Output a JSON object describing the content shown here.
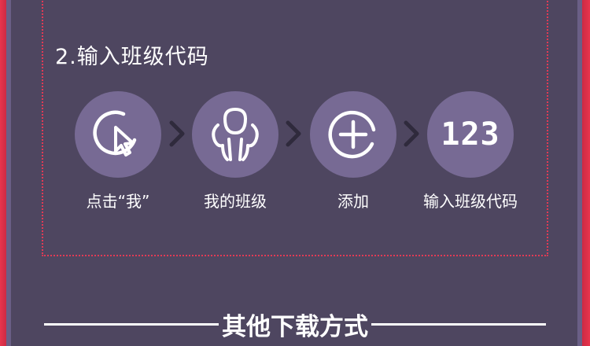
{
  "section": {
    "title": "2.输入班级代码"
  },
  "steps": [
    {
      "icon": "cursor-click-icon",
      "label": "点击“我”"
    },
    {
      "icon": "people-icon",
      "label": "我的班级"
    },
    {
      "icon": "plus-circle-icon",
      "label": "添加"
    },
    {
      "icon": "number-icon",
      "circle_text": "123",
      "label": "输入班级代码"
    }
  ],
  "footer": {
    "title": "其他下载方式"
  },
  "colors": {
    "frame_red": "#e0324a",
    "panel_purple": "#4e4660",
    "circle_purple": "#776a94",
    "dotted_border": "#e23a55",
    "chevron": "#2f2a3c"
  }
}
